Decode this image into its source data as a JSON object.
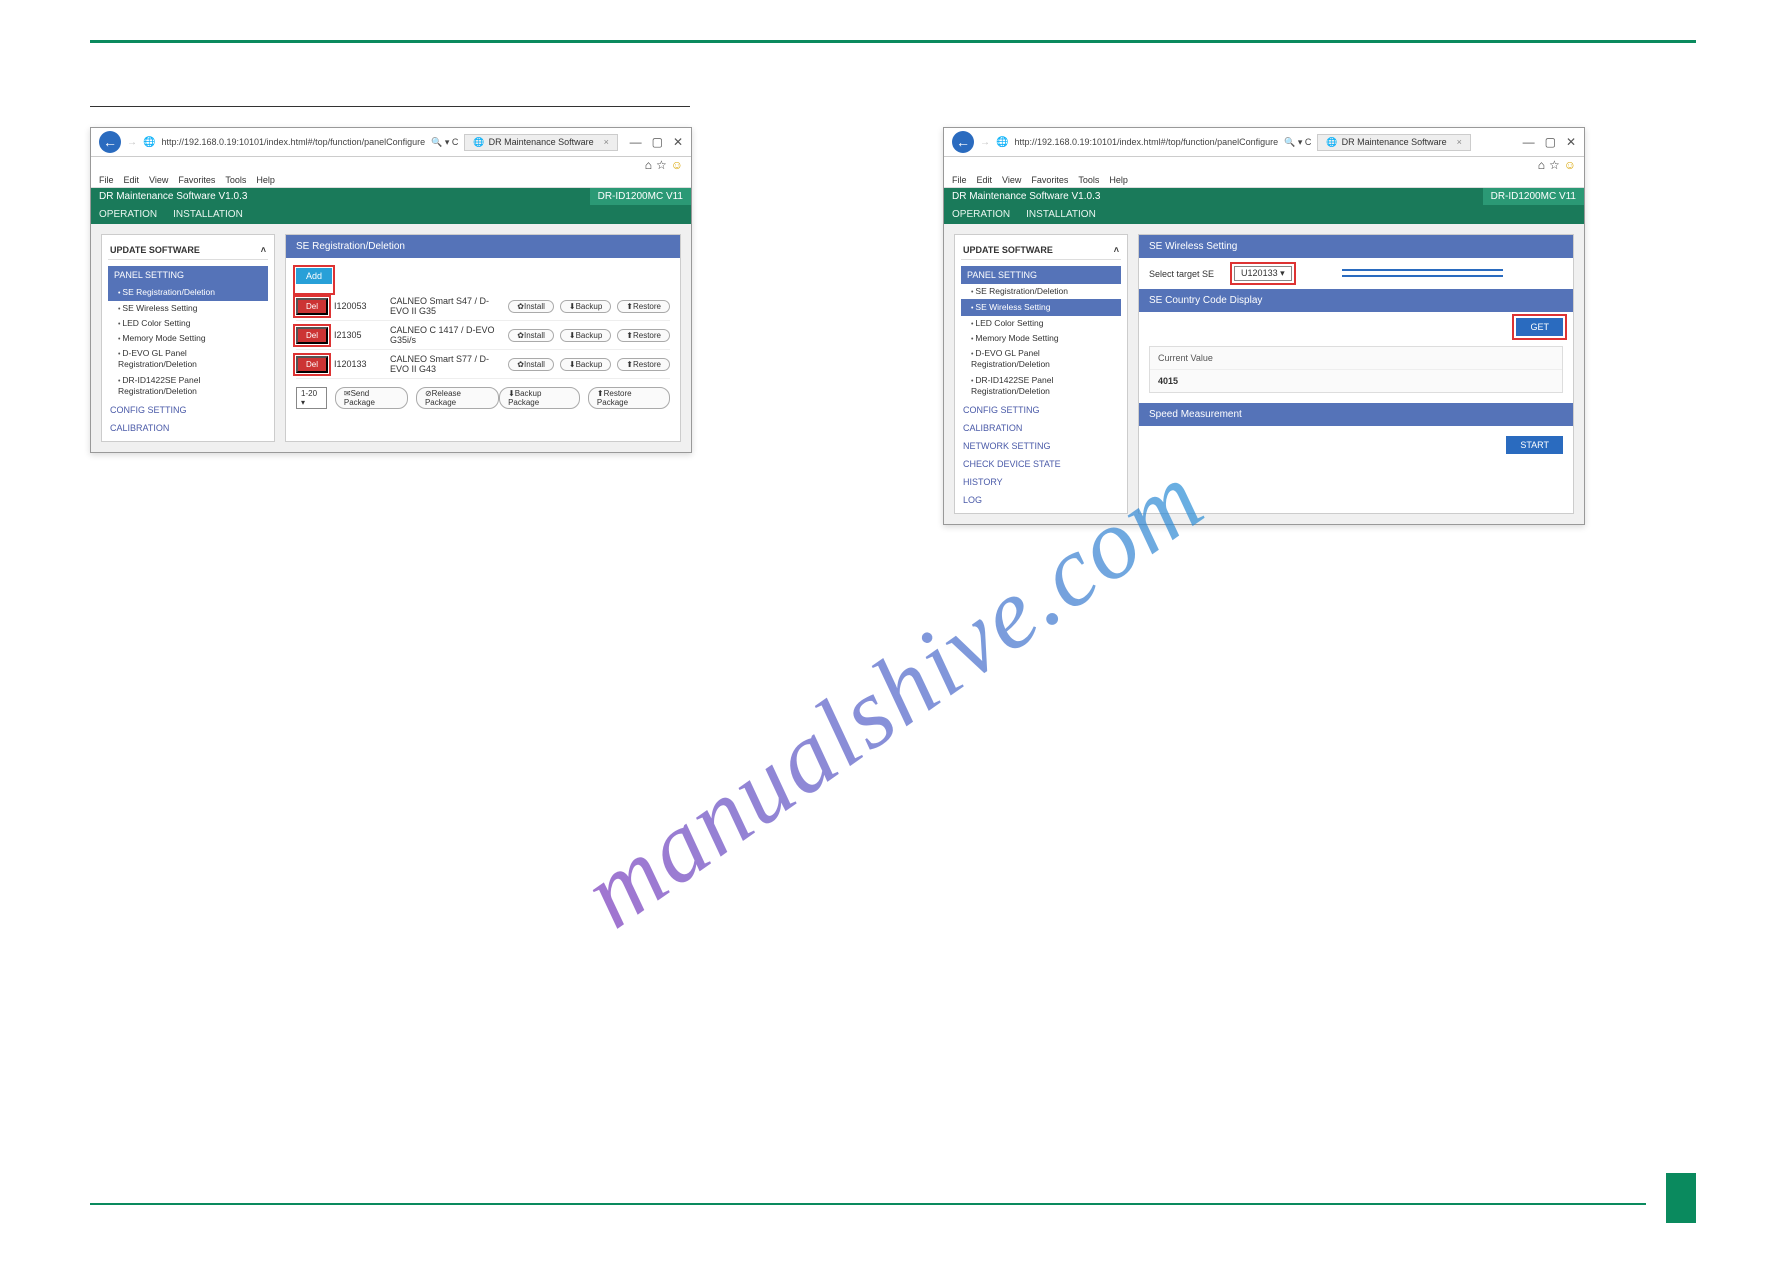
{
  "common": {
    "url": "http://192.168.0.19:10101/index.html#/top/function/panelConfigure",
    "tab_title": "DR Maintenance Software",
    "search_glyph": "🔍 ▾ C",
    "menubar": [
      "File",
      "Edit",
      "View",
      "Favorites",
      "Tools",
      "Help"
    ],
    "app_version": "DR Maintenance Software V1.0.3",
    "model": "DR-ID1200MC V11",
    "tabs": [
      "OPERATION",
      "INSTALLATION"
    ],
    "update_block": "UPDATE SOFTWARE",
    "panel_setting": "PANEL SETTING"
  },
  "left": {
    "sidebar_items": [
      "SE Registration/Deletion",
      "SE Wireless Setting",
      "LED Color Setting",
      "Memory Mode Setting",
      "D-EVO GL Panel Registration/Deletion",
      "DR-ID1422SE Panel Registration/Deletion"
    ],
    "sidebar_plain": [
      "CONFIG SETTING",
      "CALIBRATION"
    ],
    "main_header": "SE Registration/Deletion",
    "add": "Add",
    "rows": [
      {
        "del": "Del",
        "id": "I120053",
        "name": "CALNEO Smart S47 / D-EVO II G35"
      },
      {
        "del": "Del",
        "id": "I21305",
        "name": "CALNEO C 1417 / D-EVO G35i/s"
      },
      {
        "del": "Del",
        "id": "I120133",
        "name": "CALNEO Smart S77 / D-EVO II G43"
      }
    ],
    "pills": [
      "✿Install",
      "⬇Backup",
      "⬆Restore"
    ],
    "footer": {
      "range": "1-20 ▾",
      "send": "✉Send Package",
      "release": "⊘Release Package",
      "backup": "⬇Backup Package",
      "restore": "⬆Restore Package"
    }
  },
  "right": {
    "sidebar_items": [
      "SE Registration/Deletion",
      "SE Wireless Setting",
      "LED Color Setting",
      "Memory Mode Setting",
      "D-EVO GL Panel Registration/Deletion",
      "DR-ID1422SE Panel Registration/Deletion"
    ],
    "sidebar_plain": [
      "CONFIG SETTING",
      "CALIBRATION",
      "NETWORK SETTING",
      "CHECK DEVICE STATE",
      "HISTORY",
      "LOG"
    ],
    "hd1": "SE Wireless Setting",
    "select_label": "Select target SE",
    "select_value": "U120133 ▾",
    "hd2": "SE Country Code Display",
    "get": "GET",
    "cv_label": "Current Value",
    "cv_value": "4015",
    "hd3": "Speed Measurement",
    "start": "START"
  },
  "watermark": "manualshive.com"
}
